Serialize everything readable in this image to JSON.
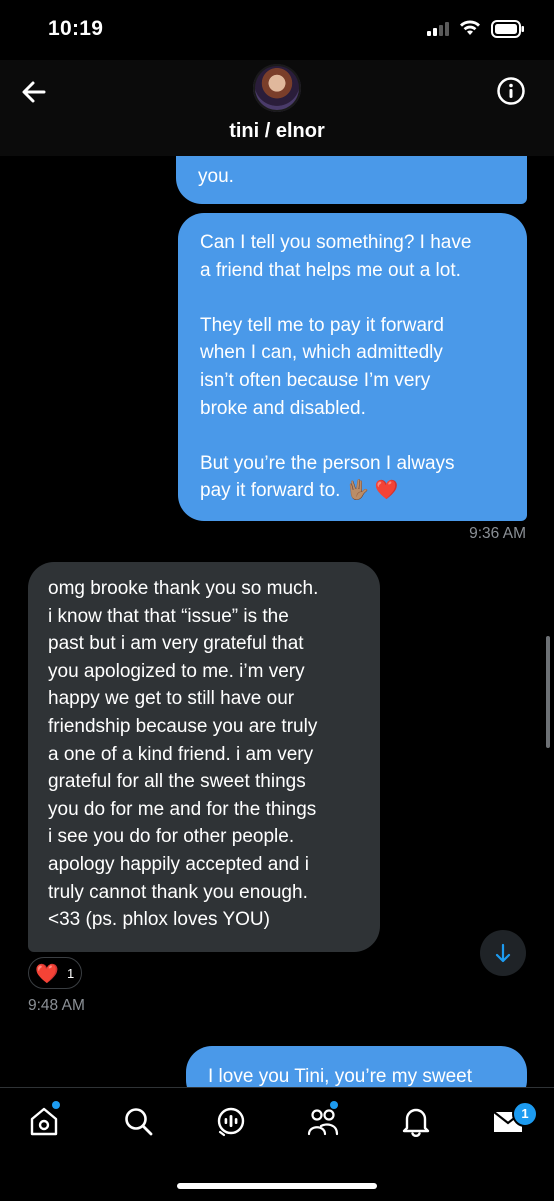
{
  "status_bar": {
    "time": "10:19"
  },
  "header": {
    "title": "tini / elnor",
    "back_icon": "arrow-left-icon",
    "info_icon": "info-icon"
  },
  "messages": [
    {
      "direction": "sent",
      "text": "you."
    },
    {
      "direction": "sent",
      "text": "Can I tell you something? I have\na friend that helps me out a lot.\n\nThey tell me to pay it forward\nwhen I can, which admittedly\nisn’t often because I’m very\nbroke and disabled.\n\nBut you’re the person I always\npay it forward to. 🖖🏽 ❤️",
      "timestamp": "9:36 AM"
    },
    {
      "direction": "received",
      "text": "omg brooke thank you so much.\ni know that that “issue” is the\npast but i am very grateful that\nyou apologized to me. i’m very\nhappy we get to still have our\nfriendship because you are truly\na one of a kind friend. i am very\ngrateful for all the sweet things\nyou do for me and for the things\ni see you do for other people.\napology happily accepted and i\ntruly cannot thank you enough.\n<33 (ps. phlox loves YOU)",
      "reaction": {
        "emoji": "❤️",
        "count": "1"
      },
      "timestamp": "9:48 AM"
    },
    {
      "direction": "sent",
      "text": "I love you Tini, you’re my sweet"
    }
  ],
  "tab_bar": {
    "items": [
      {
        "icon": "home-icon",
        "has_dot": true
      },
      {
        "icon": "search-icon"
      },
      {
        "icon": "spaces-icon"
      },
      {
        "icon": "communities-icon",
        "has_dot": true
      },
      {
        "icon": "notifications-icon"
      },
      {
        "icon": "messages-icon",
        "badge": "1"
      }
    ]
  },
  "colors": {
    "sent_bubble": "#4a99e9",
    "received_bubble": "#2f3336",
    "accent": "#1d9bf0",
    "background": "#000000"
  }
}
